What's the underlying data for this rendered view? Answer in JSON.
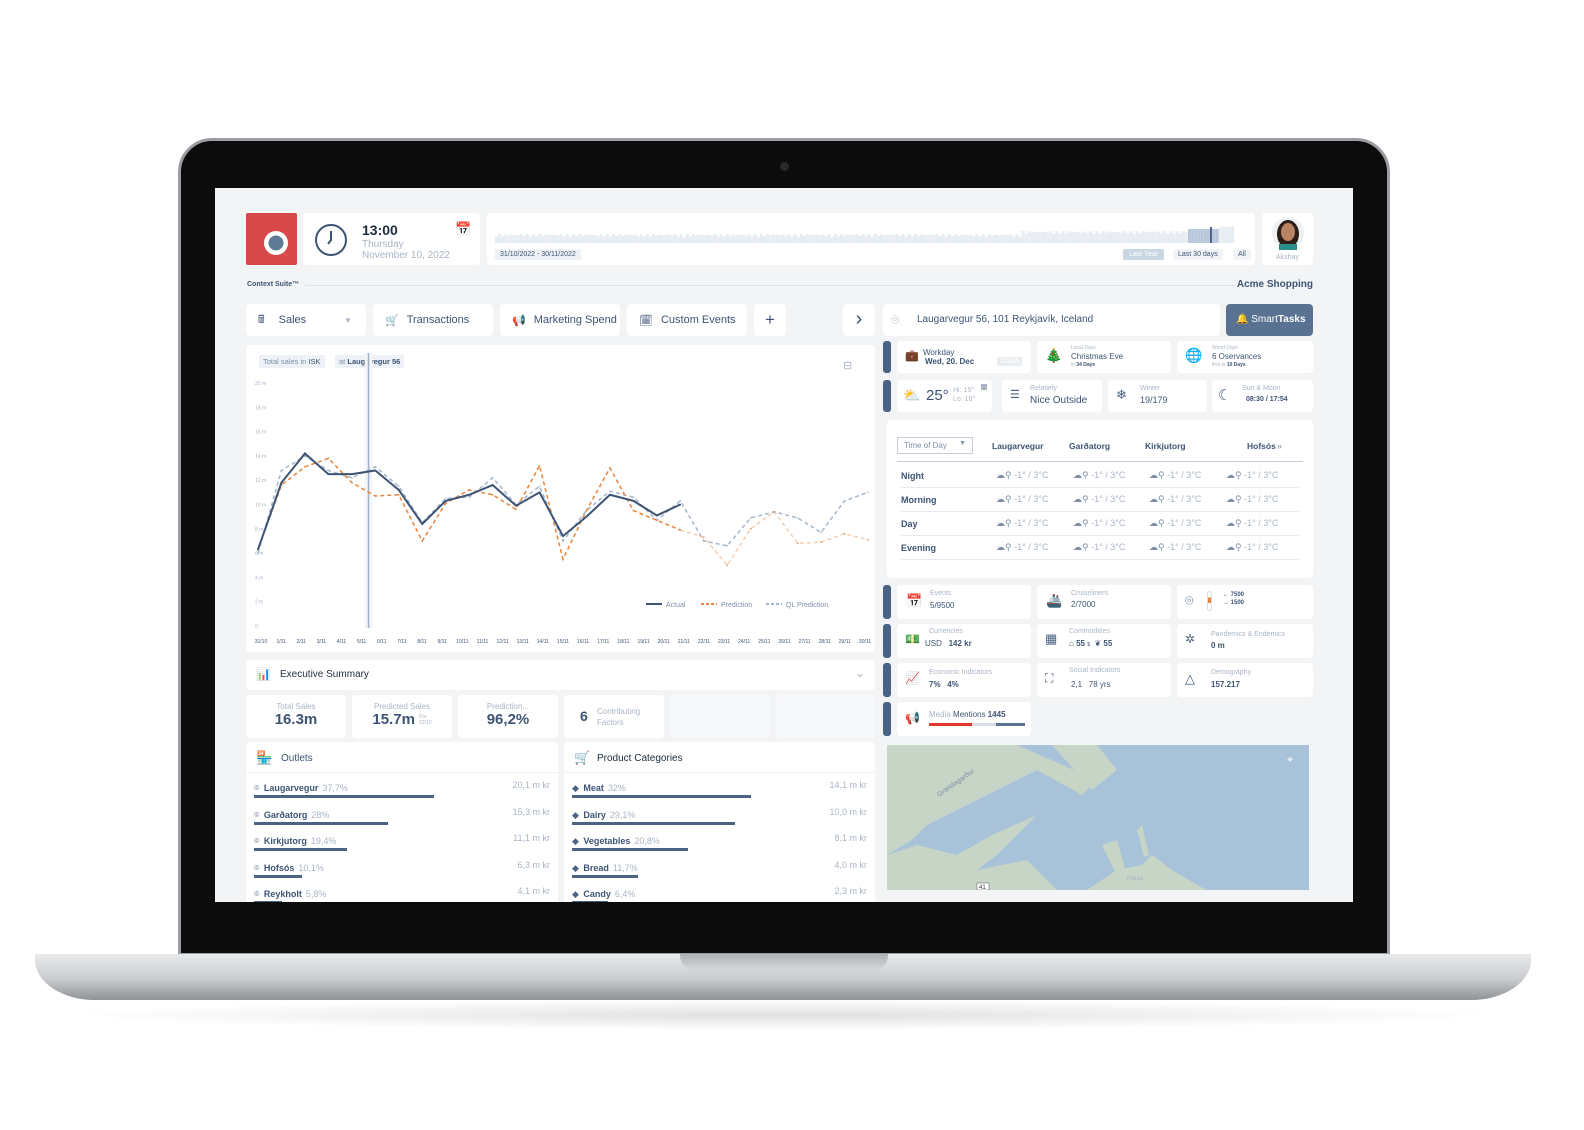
{
  "header": {
    "time": "13:00",
    "weekday": "Thursday",
    "date": "November 10, 2022",
    "date_range": "31/10/2022  -  30/11/2022",
    "range_buttons": [
      "Last Year",
      "Last 30 days",
      "All"
    ],
    "user_name": "Akshay",
    "suite_label": "Context Suite™",
    "company": "Acme Shopping"
  },
  "tabs": [
    {
      "label": "Sales",
      "icon": "cash-register-icon"
    },
    {
      "label": "Transactions",
      "icon": "cart-icon"
    },
    {
      "label": "Marketing Spend",
      "icon": "megaphone-icon"
    },
    {
      "label": "Custom Events",
      "icon": "calendar-edit-icon"
    }
  ],
  "add_tab": "+",
  "next": "›",
  "location": {
    "address": "Laugarvegur 56, 101 Reykjavík, Iceland",
    "smart_tasks_a": "Smart",
    "smart_tasks_b": "Tasks"
  },
  "context_row1": [
    {
      "title": "Workday",
      "sub": "Wed, 20. Dec",
      "badge": "DDAA"
    },
    {
      "label": "Local Days",
      "title": "Christmas Eve",
      "pre": "in",
      "sub": "34 Days"
    },
    {
      "label": "World Days",
      "title": "6 Oservances",
      "pre": "first in",
      "sub": "10 Days"
    }
  ],
  "context_row2": {
    "temp": "25°",
    "hi": "Hi: 15°",
    "lo": "Lo: 10°",
    "relative_label": "Relatiely",
    "relative_value": "Nice Outside",
    "season_label": "Winter",
    "season_value": "19/179",
    "sun_label": "Sun & Moon",
    "sun_value": "08:30 / 17:54"
  },
  "weather": {
    "selector": "Time of Day",
    "columns": [
      "Laugarvegur",
      "Garðatorg",
      "Kirkjutorg",
      "Hofsós"
    ],
    "more": "»",
    "rows": [
      {
        "label": "Night",
        "values": [
          "-1° / 3°C",
          "-1° / 3°C",
          "-1° / 3°C",
          "-1° / 3°C"
        ]
      },
      {
        "label": "Morning",
        "values": [
          "-1° / 3°C",
          "-1° / 3°C",
          "-1° / 3°C",
          "-1° / 3°C"
        ]
      },
      {
        "label": "Day",
        "values": [
          "-1° / 3°C",
          "-1° / 3°C",
          "-1° / 3°C",
          "-1° / 3°C"
        ]
      },
      {
        "label": "Evening",
        "values": [
          "-1° / 3°C",
          "-1° / 3°C",
          "-1° / 3°C",
          "-1° / 3°C"
        ]
      }
    ]
  },
  "factors": {
    "events_label": "Events",
    "events_value": "5/9500",
    "cruise_label": "Cruiseliners",
    "cruise_value": "2/7000",
    "traffic_in": "7500",
    "traffic_out": "1500",
    "currency_label": "Currencies",
    "currency_code": "USD",
    "currency_value": "142 kr",
    "commodities_label": "Commodities",
    "commodity_a": "55",
    "commodity_b": "55",
    "commodity_unit": "$",
    "pandemics_label": "Pandemics & Endemics",
    "pandemics_value": "0 m",
    "econ_label": "Economic Indicators",
    "econ_a": "7%",
    "econ_b": "4%",
    "social_label": "Social Indicators",
    "social_a": "2,1",
    "social_b": "78 yrs",
    "demo_label": "Demography",
    "demo_value": "157.217",
    "media_label": "Media",
    "media_mentions": "Mentions",
    "media_value": "1445",
    "media_split": [
      0.45,
      0.25,
      0.3
    ]
  },
  "map": {
    "street": "Grandagarður",
    "landmark": "Harpa",
    "route": "41",
    "water": "#a8c2da",
    "land": "#c6d5c5"
  },
  "chart_tags": {
    "a_pre": "Total sales in",
    "a_val": "ISK",
    "b_pre": "at",
    "b_val": "Laugavegur 56"
  },
  "chart_data": {
    "type": "line",
    "ylim": [
      0,
      20
    ],
    "y_ticks": [
      "0",
      "2 m",
      "4 m",
      "6 m",
      "8 m",
      "10 m",
      "12 m",
      "14 m",
      "16 m",
      "18 m",
      "20 m"
    ],
    "x_labels": [
      "31/10",
      "1/11",
      "2/11",
      "3/11",
      "4/11",
      "5/11",
      "6/11",
      "7/11",
      "8/11",
      "9/11",
      "10/11",
      "11/11",
      "12/11",
      "13/11",
      "14/11",
      "15/11",
      "16/11",
      "17/11",
      "18/11",
      "19/11",
      "20/11",
      "21/11",
      "22/11",
      "23/11",
      "24/11",
      "25/11",
      "26/11",
      "27/11",
      "28/11",
      "29/11",
      "30/11"
    ],
    "today_marker": "10/11",
    "legend_position": "bottom-right",
    "series": [
      {
        "name": "Actual",
        "color": "#3d5475",
        "dash": "none",
        "values": [
          6.3,
          11.8,
          14.2,
          12.5,
          12.5,
          12.8,
          11.2,
          8.4,
          10.3,
          10.8,
          11.6,
          9.9,
          11.0,
          7.4,
          9.0,
          10.8,
          10.3,
          9.1,
          10.0
        ]
      },
      {
        "name": "Prediction",
        "color": "#e8843c",
        "dash": "dashed",
        "values": [
          6.3,
          11.6,
          13.1,
          13.8,
          11.8,
          10.7,
          10.8,
          7.0,
          10.1,
          11.2,
          10.8,
          9.6,
          13.2,
          5.5,
          9.5,
          13.0,
          9.5,
          8.7,
          7.9,
          7.3,
          5.0,
          8.0,
          9.4,
          6.8,
          6.9,
          7.6,
          7.1
        ]
      },
      {
        "name": "QL Prediction",
        "color": "#a3b5cc",
        "dash": "dashed",
        "values": [
          6.0,
          12.8,
          14.0,
          12.8,
          12.2,
          13.1,
          11.5,
          8.5,
          10.5,
          10.6,
          12.2,
          10.0,
          11.5,
          7.0,
          9.5,
          11.1,
          10.6,
          8.7,
          10.3,
          7.0,
          6.6,
          8.9,
          9.4,
          8.9,
          7.7,
          10.3,
          11.0
        ]
      }
    ]
  },
  "summary": {
    "title": "Executive Summary",
    "kpis": [
      {
        "label": "Total Sales",
        "value": "16.3m"
      },
      {
        "label": "Predicted  Sales",
        "value": "15.7m",
        "note_a": "For",
        "note_b": "22/12"
      },
      {
        "label": "Prediction...",
        "value": "96,2%"
      }
    ],
    "factors_count": "6",
    "factors_label_a": "Contributing",
    "factors_label_b": "Factors"
  },
  "outlets": {
    "title": "Outlets",
    "items": [
      {
        "name": "Laugarvegur",
        "pct": "37,7%",
        "amount": "20,1 m kr",
        "share": 0.377
      },
      {
        "name": "Garðatorg",
        "pct": "28%",
        "amount": "15,3 m kr",
        "share": 0.28
      },
      {
        "name": "Kirkjutorg",
        "pct": "19,4%",
        "amount": "11,1 m kr",
        "share": 0.194
      },
      {
        "name": "Hofsós",
        "pct": "10,1%",
        "amount": "6,3 m kr",
        "share": 0.101
      },
      {
        "name": "Reykholt",
        "pct": "5,8%",
        "amount": "4,1 m kr",
        "share": 0.058
      }
    ]
  },
  "categories": {
    "title": "Product Categories",
    "items": [
      {
        "name": "Meat",
        "pct": "32%",
        "amount": "14,1 m kr",
        "share": 0.32,
        "icon": "meat-icon"
      },
      {
        "name": "Dairy",
        "pct": "29,1%",
        "amount": "10,0 m kr",
        "share": 0.291,
        "icon": "cow-icon"
      },
      {
        "name": "Vegetables",
        "pct": "20,8%",
        "amount": "8,1 m kr",
        "share": 0.208,
        "icon": "leaf-icon"
      },
      {
        "name": "Bread",
        "pct": "11,7%",
        "amount": "4,0 m kr",
        "share": 0.117,
        "icon": "bread-icon"
      },
      {
        "name": "Candy",
        "pct": "6,4%",
        "amount": "2,3 m kr",
        "share": 0.064,
        "icon": "candy-icon"
      }
    ]
  },
  "colors": {
    "brand": "#d94848",
    "accent": "#4a6283",
    "muted": "#a9b5c4",
    "alert": "#e03a2f"
  }
}
